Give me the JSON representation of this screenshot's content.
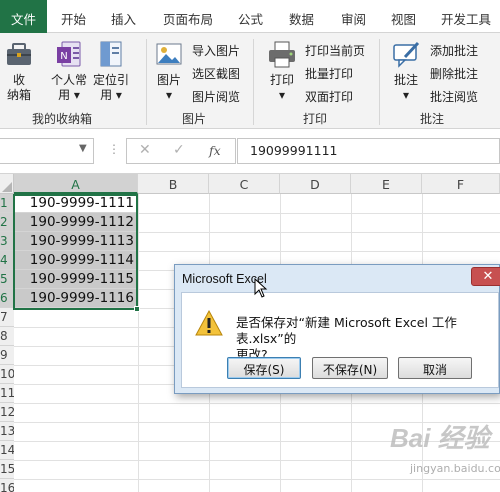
{
  "ribbon_tabs": [
    {
      "label": "文件",
      "active": true
    },
    {
      "label": "开始"
    },
    {
      "label": "插入"
    },
    {
      "label": "页面布局"
    },
    {
      "label": "公式"
    },
    {
      "label": "数据"
    },
    {
      "label": "审阅"
    },
    {
      "label": "视图"
    },
    {
      "label": "开发工具"
    }
  ],
  "groups": {
    "toolbox": {
      "label": "我的收纳箱",
      "buttons": {
        "storage_line1": "收",
        "storage_line2": "纳箱",
        "personal_line1": "个人常",
        "personal_line2": "用",
        "locate_line1": "定位引",
        "locate_line2": "用"
      }
    },
    "picture": {
      "label": "图片",
      "big": "图片",
      "items": [
        "导入图片",
        "选区截图",
        "图片阅览"
      ]
    },
    "print": {
      "label": "打印",
      "big": "打印",
      "items": [
        "打印当前页",
        "批量打印",
        "双面打印"
      ]
    },
    "comment": {
      "label": "批注",
      "big": "批注",
      "items": [
        "添加批注",
        "删除批注",
        "批注阅览"
      ]
    }
  },
  "formula_bar": {
    "fx": "fx",
    "value": "19099991111"
  },
  "columns": [
    "A",
    "B",
    "C",
    "D",
    "E",
    "F"
  ],
  "rows": [
    "1",
    "2",
    "3",
    "4",
    "5",
    "6",
    "7",
    "8",
    "9",
    "10",
    "11",
    "12",
    "13",
    "14",
    "15",
    "16"
  ],
  "cells_a": [
    "190-9999-1111",
    "190-9999-1112",
    "190-9999-1113",
    "190-9999-1114",
    "190-9999-1115",
    "190-9999-1116"
  ],
  "dialog": {
    "title": "Microsoft Excel",
    "message_line1": "是否保存对“新建 Microsoft Excel 工作表.xlsx”的",
    "message_line2": "更改?",
    "save": "保存(S)",
    "dont_save": "不保存(N)",
    "cancel": "取消",
    "close": "✕"
  },
  "watermark": {
    "main": "Bai 经验",
    "sub": "jingyan.baidu.com"
  },
  "colors": {
    "excel_green": "#217346",
    "dialog_frame": "#dbe8f5",
    "close_red": "#c75050"
  }
}
